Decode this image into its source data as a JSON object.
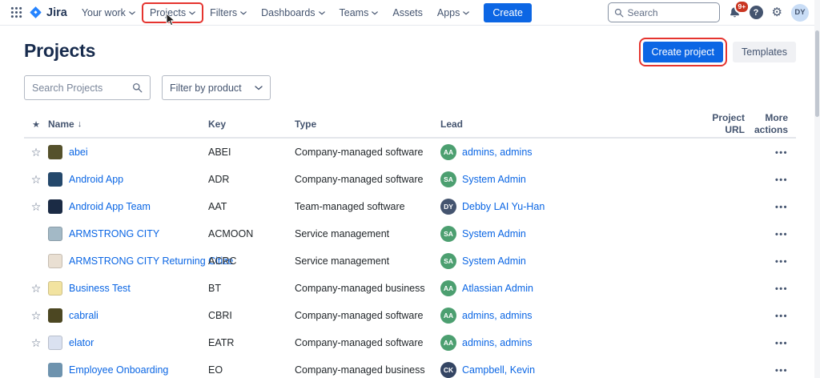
{
  "colors": {
    "accent_blue": "#0C66E4",
    "annotation_red": "#E5342F",
    "link_blue": "#0B66E4",
    "badge_red": "#CA3521"
  },
  "nav": {
    "brand": "Jira",
    "items": [
      {
        "label": "Your work",
        "chevron": true,
        "annotated": false
      },
      {
        "label": "Projects",
        "chevron": true,
        "annotated": true
      },
      {
        "label": "Filters",
        "chevron": true,
        "annotated": false
      },
      {
        "label": "Dashboards",
        "chevron": true,
        "annotated": false
      },
      {
        "label": "Teams",
        "chevron": true,
        "annotated": false
      },
      {
        "label": "Assets",
        "chevron": false,
        "annotated": false
      },
      {
        "label": "Apps",
        "chevron": true,
        "annotated": false
      }
    ],
    "create_label": "Create",
    "search_placeholder": "Search",
    "notification_badge": "9+",
    "avatar_initials": "DY"
  },
  "page": {
    "title": "Projects",
    "create_project_label": "Create project",
    "templates_label": "Templates",
    "search_placeholder": "Search Projects",
    "filter_label": "Filter by product"
  },
  "table": {
    "headers": {
      "name": "Name",
      "key": "Key",
      "type": "Type",
      "lead": "Lead",
      "project_url": "Project URL",
      "more_actions": "More actions"
    },
    "sort_indicator": "↓",
    "rows": [
      {
        "name": "abei",
        "key": "ABEI",
        "type": "Company-managed software",
        "lead": "admins, admins",
        "lead_initials": "AA",
        "lead_color": "#4C9F70",
        "starred": true,
        "icon_color": "#55512B",
        "icon_border": false
      },
      {
        "name": "Android App",
        "key": "ADR",
        "type": "Company-managed software",
        "lead": "System Admin",
        "lead_initials": "SA",
        "lead_color": "#4C9F70",
        "starred": true,
        "icon_color": "#24486B",
        "icon_border": false
      },
      {
        "name": "Android App Team",
        "key": "AAT",
        "type": "Team-managed software",
        "lead": "Debby LAI Yu-Han",
        "lead_initials": "DY",
        "lead_color": "#44546F",
        "starred": true,
        "icon_color": "#1B2B45",
        "icon_border": false
      },
      {
        "name": "ARMSTRONG CITY",
        "key": "ACMOON",
        "type": "Service management",
        "lead": "System Admin",
        "lead_initials": "SA",
        "lead_color": "#4C9F70",
        "starred": false,
        "icon_color": "#A3B9C6",
        "icon_border": true
      },
      {
        "name": "ARMSTRONG CITY Returning Citize",
        "key": "ACRC",
        "type": "Service management",
        "lead": "System Admin",
        "lead_initials": "SA",
        "lead_color": "#4C9F70",
        "starred": false,
        "icon_color": "#E9DFD2",
        "icon_border": true
      },
      {
        "name": "Business Test",
        "key": "BT",
        "type": "Company-managed business",
        "lead": "Atlassian Admin",
        "lead_initials": "AA",
        "lead_color": "#4C9F70",
        "starred": true,
        "icon_color": "#F2E3A0",
        "icon_border": true
      },
      {
        "name": "cabrali",
        "key": "CBRI",
        "type": "Company-managed software",
        "lead": "admins, admins",
        "lead_initials": "AA",
        "lead_color": "#4C9F70",
        "starred": true,
        "icon_color": "#4C4722",
        "icon_border": false
      },
      {
        "name": "elator",
        "key": "EATR",
        "type": "Company-managed software",
        "lead": "admins, admins",
        "lead_initials": "AA",
        "lead_color": "#4C9F70",
        "starred": true,
        "icon_color": "#DAE1F0",
        "icon_border": true
      },
      {
        "name": "Employee Onboarding",
        "key": "EO",
        "type": "Company-managed business",
        "lead": "Campbell, Kevin",
        "lead_initials": "CK",
        "lead_color": "#344563",
        "starred": false,
        "icon_color": "#6E93AE",
        "icon_border": false
      }
    ]
  },
  "icons": {
    "star": "☆",
    "star_header": "★",
    "more": "•••",
    "gear": "⚙"
  }
}
